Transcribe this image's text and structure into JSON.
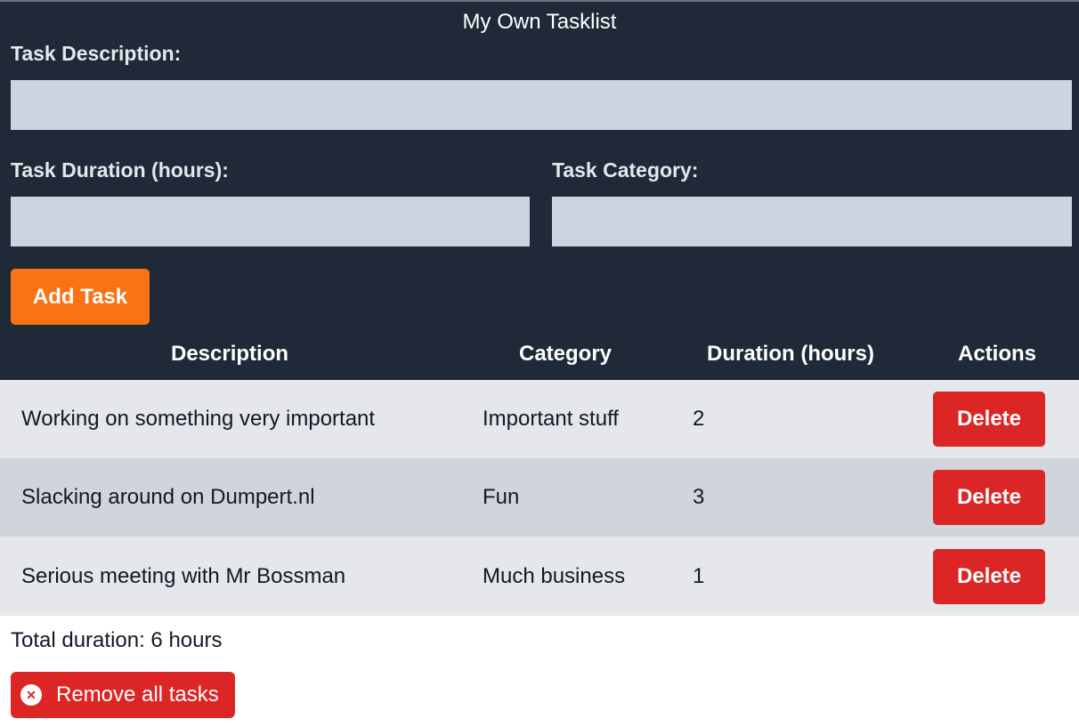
{
  "app": {
    "title": "My Own Tasklist"
  },
  "form": {
    "description_label": "Task Description:",
    "description_value": "",
    "duration_label": "Task Duration (hours):",
    "duration_value": "",
    "category_label": "Task Category:",
    "category_value": "",
    "add_button_label": "Add Task"
  },
  "table": {
    "headers": [
      "Description",
      "Category",
      "Duration (hours)",
      "Actions"
    ],
    "rows": [
      {
        "description": "Working on something very important",
        "category": "Important stuff",
        "duration": "2",
        "action_label": "Delete"
      },
      {
        "description": "Slacking around on Dumpert.nl",
        "category": "Fun",
        "duration": "3",
        "action_label": "Delete"
      },
      {
        "description": "Serious meeting with Mr Bossman",
        "category": "Much business",
        "duration": "1",
        "action_label": "Delete"
      }
    ]
  },
  "footer": {
    "total_text": "Total duration: 6 hours",
    "remove_all_label": "Remove all tasks",
    "remove_all_icon": "x-circle-icon"
  },
  "colors": {
    "panel_bg": "#1f2937",
    "input_bg": "#cbd5e1",
    "add_button": "#f97316",
    "delete_button": "#dc2626",
    "row_light": "#e5e7eb",
    "row_dark": "#d1d5db"
  }
}
